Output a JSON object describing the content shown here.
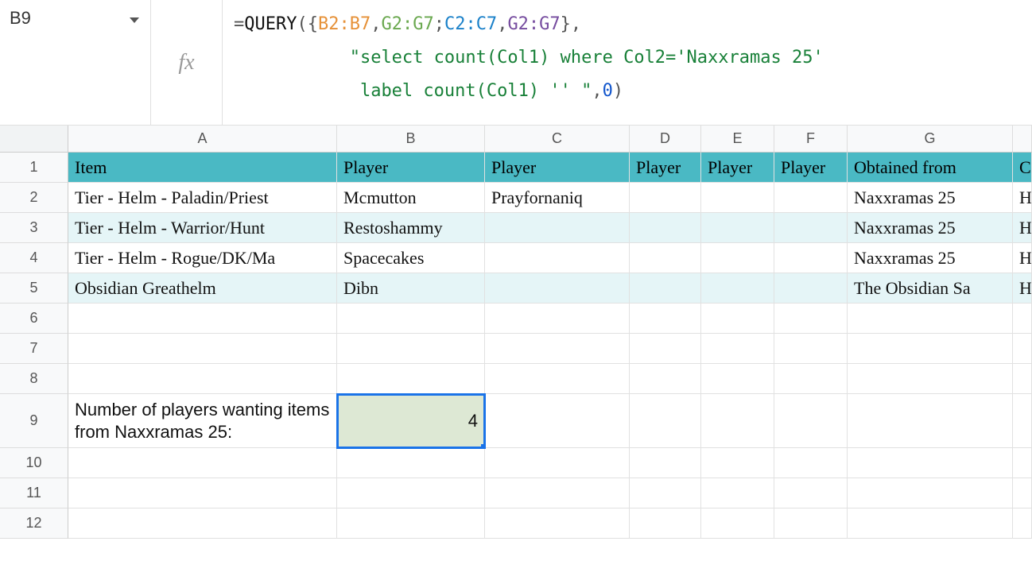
{
  "name_box": {
    "value": "B9"
  },
  "fx_label": "fx",
  "formula": {
    "prefix": "=",
    "fn": "QUERY",
    "ranges": {
      "r1": "B2:B7",
      "r2": "G2:G7",
      "r3": "C2:C7",
      "r4": "G2:G7"
    },
    "string_line1": "\"select count(Col1) where Col2='Naxxramas 25'",
    "string_line2": " label count(Col1) '' \"",
    "arg_num": "0"
  },
  "columns": [
    "",
    "A",
    "B",
    "C",
    "D",
    "E",
    "F",
    "G",
    ""
  ],
  "rows": {
    "headers": [
      "Item",
      "Player",
      "Player",
      "Player",
      "Player",
      "Player",
      "Obtained from",
      "C"
    ],
    "data": [
      {
        "n": "2",
        "band": false,
        "cells": [
          "Tier - Helm - Paladin/Priest",
          "Mcmutton",
          "Prayfornaniq",
          "",
          "",
          "",
          "Naxxramas 25",
          "H"
        ]
      },
      {
        "n": "3",
        "band": true,
        "cells": [
          "Tier - Helm - Warrior/Hunt",
          "Restoshammy",
          "",
          "",
          "",
          "",
          "Naxxramas 25",
          "H"
        ]
      },
      {
        "n": "4",
        "band": false,
        "cells": [
          "Tier - Helm - Rogue/DK/Ma",
          "Spacecakes",
          "",
          "",
          "",
          "",
          "Naxxramas 25",
          "H"
        ]
      },
      {
        "n": "5",
        "band": true,
        "cells": [
          "Obsidian Greathelm",
          "Dibn",
          "",
          "",
          "",
          "",
          "The Obsidian Sa",
          "H"
        ]
      }
    ],
    "empty": [
      "6",
      "7",
      "8"
    ],
    "result_row": {
      "n": "9",
      "label": "Number of players wanting items from Naxxramas 25:",
      "value": "4"
    },
    "trailing": [
      "10",
      "11",
      "12"
    ]
  }
}
